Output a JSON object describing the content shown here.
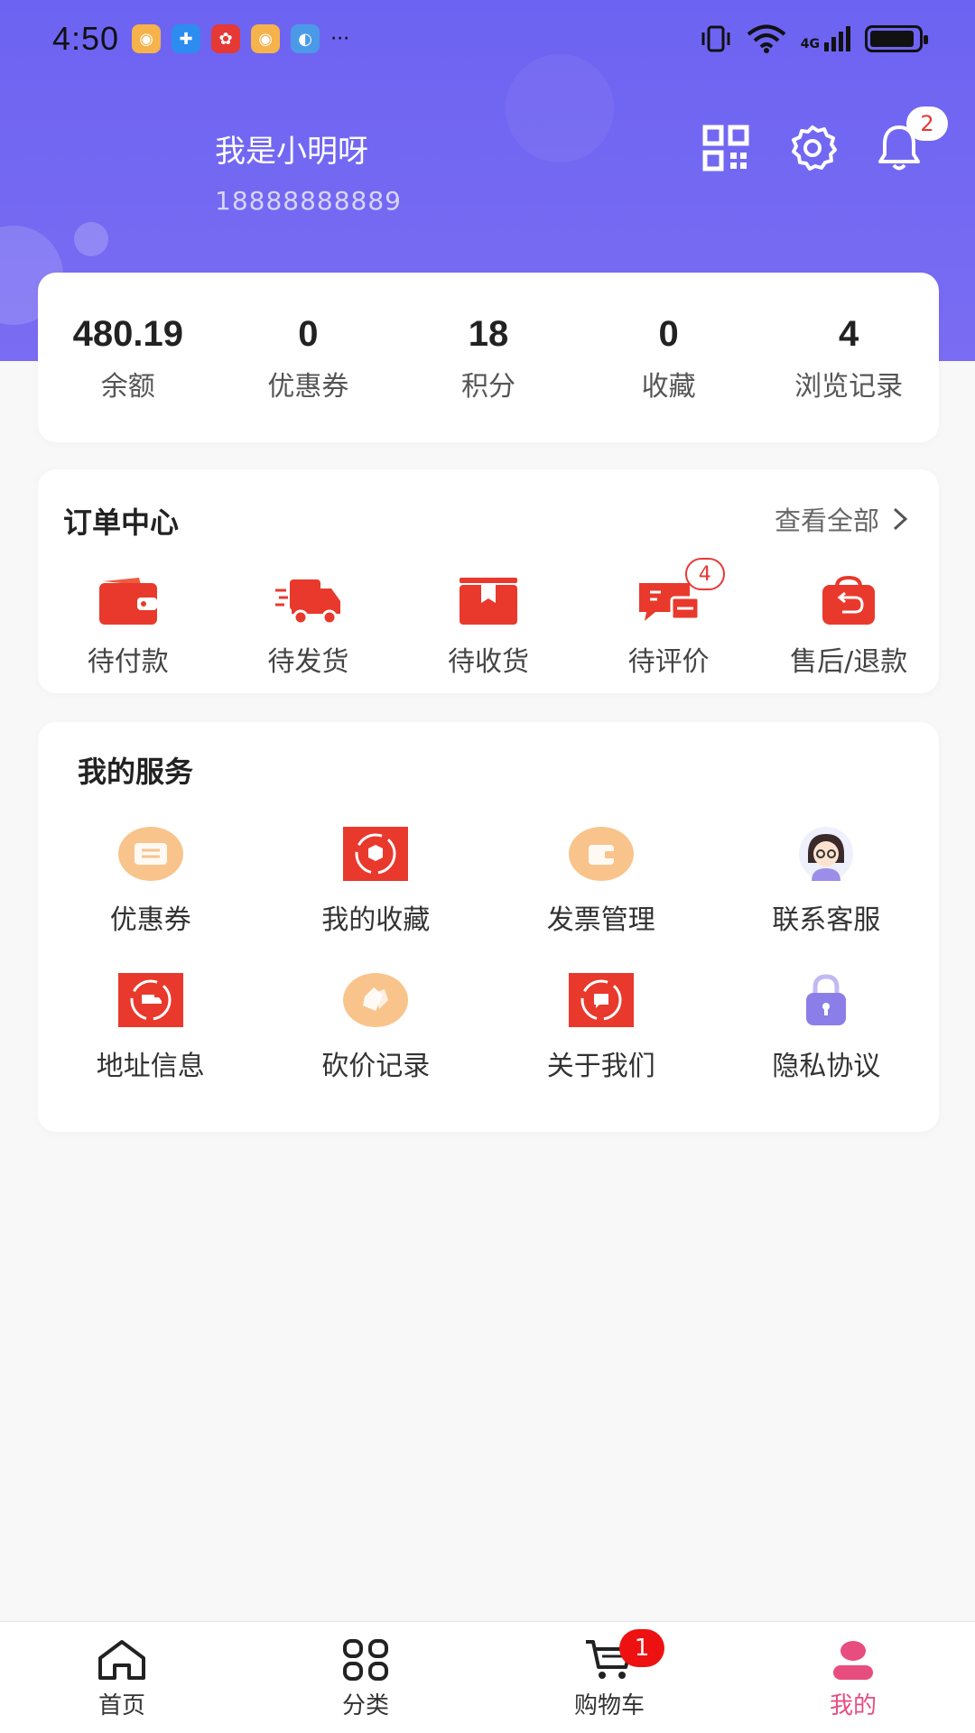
{
  "status_bar": {
    "time": "4:50",
    "more": "···",
    "network": "4G"
  },
  "user": {
    "name": "我是小明呀",
    "phone": "18888888889",
    "notification_count": "2"
  },
  "stats": [
    {
      "value": "480.19",
      "label": "余额"
    },
    {
      "value": "0",
      "label": "优惠券"
    },
    {
      "value": "18",
      "label": "积分"
    },
    {
      "value": "0",
      "label": "收藏"
    },
    {
      "value": "4",
      "label": "浏览记录"
    }
  ],
  "orders": {
    "title": "订单中心",
    "view_all": "查看全部",
    "items": [
      {
        "label": "待付款",
        "icon": "wallet-icon"
      },
      {
        "label": "待发货",
        "icon": "truck-icon"
      },
      {
        "label": "待收货",
        "icon": "package-icon"
      },
      {
        "label": "待评价",
        "icon": "review-icon",
        "badge": "4"
      },
      {
        "label": "售后/退款",
        "icon": "refund-bag-icon"
      }
    ]
  },
  "services": {
    "title": "我的服务",
    "items": [
      {
        "label": "优惠券",
        "icon": "coupon-icon"
      },
      {
        "label": "我的收藏",
        "icon": "favorites-icon"
      },
      {
        "label": "发票管理",
        "icon": "invoice-wallet-icon"
      },
      {
        "label": "联系客服",
        "icon": "customer-service-avatar-icon"
      },
      {
        "label": "地址信息",
        "icon": "address-truck-icon"
      },
      {
        "label": "砍价记录",
        "icon": "bargain-tag-icon"
      },
      {
        "label": "关于我们",
        "icon": "about-chat-icon"
      },
      {
        "label": "隐私协议",
        "icon": "lock-icon"
      }
    ]
  },
  "tabs": [
    {
      "label": "首页",
      "icon": "home-icon"
    },
    {
      "label": "分类",
      "icon": "category-grid-icon"
    },
    {
      "label": "购物车",
      "icon": "cart-icon",
      "badge": "1"
    },
    {
      "label": "我的",
      "icon": "profile-icon",
      "active": true
    }
  ],
  "colors": {
    "header": "#6d63f2",
    "accent_red": "#e8392c",
    "active_tab": "#e84d80",
    "background": "#f9f8f8"
  }
}
